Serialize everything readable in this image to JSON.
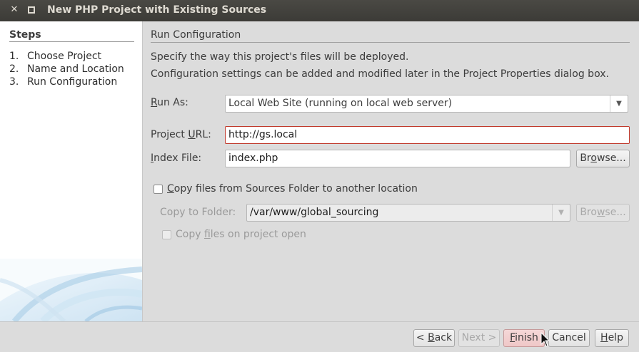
{
  "window": {
    "title": "New PHP Project with Existing Sources",
    "close_glyph": "✕",
    "maximize_glyph": "◘"
  },
  "steps": {
    "heading": "Steps",
    "items": [
      {
        "num": "1.",
        "label": "Choose Project"
      },
      {
        "num": "2.",
        "label": "Name and Location"
      },
      {
        "num": "3.",
        "label": "Run Configuration"
      }
    ]
  },
  "panel": {
    "title": "Run Configuration",
    "desc_line1": "Specify the way this project's files will be deployed.",
    "desc_line2": "Configuration settings can be added and modified later in the Project Properties dialog box.",
    "run_as": {
      "mnemonic": "R",
      "label_rest": "un As:",
      "value": "Local Web Site (running on local web server)"
    },
    "project_url": {
      "label_pre": "Project ",
      "mnemonic": "U",
      "label_post": "RL:",
      "value": "http://gs.local"
    },
    "index_file": {
      "mnemonic": "I",
      "label_rest": "ndex File:",
      "value": "index.php",
      "browse_pre": "Br",
      "browse_mn": "o",
      "browse_post": "wse..."
    },
    "copy_files": {
      "mnemonic": "C",
      "label_rest": "opy files from Sources Folder to another location",
      "checked": false
    },
    "copy_to_folder": {
      "label": "Copy to Folder:",
      "value": "/var/www/global_sourcing",
      "browse_pre": "Bro",
      "browse_mn": "w",
      "browse_post": "se..."
    },
    "copy_on_open": {
      "label_pre": "Copy ",
      "mnemonic": "f",
      "label_post": "iles on project open",
      "checked": false
    }
  },
  "buttons": {
    "back": {
      "pre": "< ",
      "mn": "B",
      "post": "ack"
    },
    "next": {
      "pre": "Next ",
      "post": ">"
    },
    "finish": {
      "mn": "F",
      "post": "inish"
    },
    "cancel": "Cancel",
    "help": {
      "mn": "H",
      "post": "elp"
    }
  },
  "colors": {
    "titlebar": "#3c3b37",
    "error_border": "#c0392b",
    "finish_highlight": "#efc7c7"
  }
}
